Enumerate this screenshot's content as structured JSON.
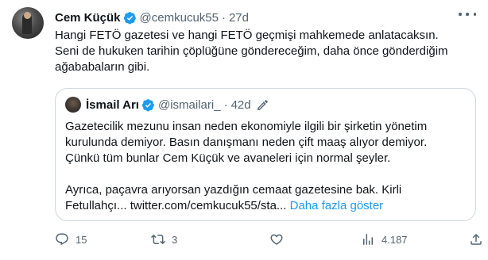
{
  "author": {
    "name": "Cem Küçük",
    "handle": "@cemkucuk55",
    "separator": "·",
    "time": "27d"
  },
  "tweet": {
    "lines": [
      "Hangi FETÖ gazetesi ve hangi FETÖ geçmişi mahkemede anlatacaksın.",
      "Seni de hukuken tarihin çöplüğüne göndereceğim, daha önce gönderdiğim",
      "ağababaların gibi."
    ]
  },
  "quote": {
    "name": "İsmail Arı",
    "handle": "@ismailari_",
    "separator": "·",
    "time": "42d",
    "lines": [
      "Gazetecilik mezunu insan neden ekonomiyle ilgili bir şirketin yönetim",
      "kurulunda demiyor. Basın danışmanı neden çift maaş alıyor demiyor.",
      "Çünkü tüm bunlar Cem Küçük ve avaneleri için normal şeyler.",
      "",
      "Ayrıca, paçavra arıyorsan yazdığın cemaat gazetesine bak. Kirli"
    ],
    "last_line_text": "Fetullahçı... twitter.com/cemkucuk55/sta...",
    "show_more": "Daha fazla göster"
  },
  "actions": {
    "replies": "15",
    "retweets": "3",
    "likes": "",
    "views": "4.187"
  },
  "colors": {
    "text": "#0f1419",
    "muted": "#536471",
    "accent": "#1d9bf0",
    "border": "#cfd9de"
  },
  "icons": [
    "verified-badge-icon",
    "more-icon",
    "edit-icon",
    "reply-icon",
    "retweet-icon",
    "like-icon",
    "views-icon",
    "share-icon"
  ]
}
